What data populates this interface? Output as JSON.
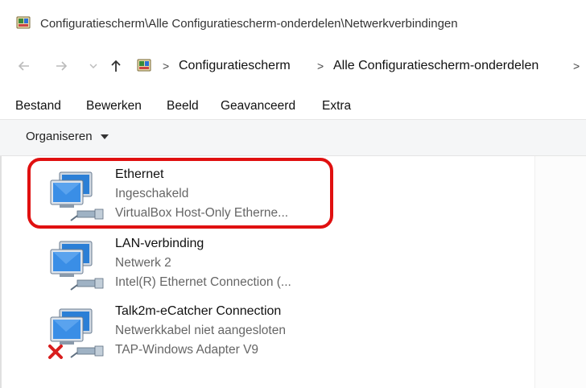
{
  "window": {
    "title": "Configuratiescherm\\Alle Configuratiescherm-onderdelen\\Netwerkverbindingen",
    "icon": "control-panel-icon"
  },
  "address": {
    "icon": "control-panel-icon",
    "breadcrumbs": [
      "Configuratiescherm",
      "Alle Configuratiescherm-onderdelen"
    ],
    "separator": ">"
  },
  "menu": {
    "items": [
      "Bestand",
      "Bewerken",
      "Beeld",
      "Geavanceerd",
      "Extra"
    ]
  },
  "commandbar": {
    "organise_label": "Organiseren"
  },
  "connections": [
    {
      "name": "Ethernet",
      "status": "Ingeschakeld",
      "adapter": "VirtualBox Host-Only Etherne...",
      "disconnected": false,
      "highlighted": true
    },
    {
      "name": "LAN-verbinding",
      "status": "Netwerk  2",
      "adapter": "Intel(R) Ethernet Connection (...",
      "disconnected": false,
      "highlighted": false
    },
    {
      "name": "Talk2m-eCatcher Connection",
      "status": "Netwerkkabel niet aangesloten",
      "adapter": "TAP-Windows Adapter V9",
      "disconnected": true,
      "highlighted": false
    }
  ],
  "colors": {
    "highlight": "#e01010",
    "error_x": "#d81e1e",
    "monitor_blue": "#2b7fd6"
  }
}
